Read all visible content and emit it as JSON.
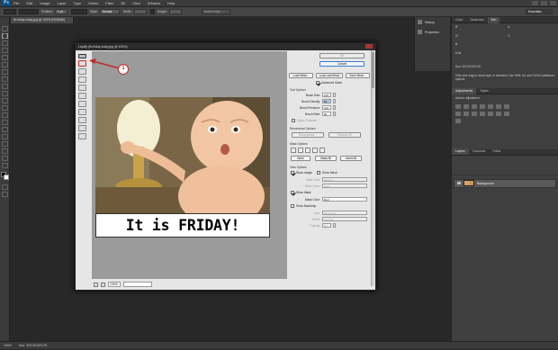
{
  "app": {
    "logo": "Ps"
  },
  "menu": [
    "File",
    "Edit",
    "Image",
    "Layer",
    "Type",
    "Select",
    "Filter",
    "3D",
    "View",
    "Window",
    "Help"
  ],
  "options_bar": {
    "feather_label": "Feather:",
    "feather_value": "0 px",
    "style_label": "Style:",
    "style_value": "Normal",
    "width_label": "Width:",
    "height_label": "Height:",
    "refine_button": "Refine Edge..."
  },
  "document_tab": "fb-friday-baby.jpg @ 100% (RGB/8#)",
  "dock": {
    "items": [
      {
        "label": "History",
        "icon": "history-icon"
      },
      {
        "label": "Properties",
        "icon": "properties-icon"
      }
    ]
  },
  "workspace_selector": "Essentials",
  "right_panel": {
    "top_tabs": [
      "Color",
      "Swatches",
      "Info"
    ],
    "info_lines": [
      "R:",
      "G:",
      "B:",
      "8-bit",
      "X:",
      "Y:",
      "Doc: 323.2K/323.2K",
      "Click and drag to move layer or selection. Use Shift, Alt, and Ctrl for additional options."
    ],
    "adjust_tabs": [
      "Adjustments",
      "Styles"
    ],
    "adjust_title": "Add an adjustment",
    "layers_tabs": [
      "Layers",
      "Channels",
      "Paths"
    ],
    "layer_name": "Background"
  },
  "status_bar": {
    "zoom": "100%",
    "doc": "Doc: 323.2K/323.2K",
    "tabs": [
      "Mini Bridge",
      "Timeline"
    ]
  },
  "callout_number": "1",
  "liquify": {
    "title": "Liquify (fb-friday-baby.jpg @ 100%)",
    "caption": "It is FRIDAY!",
    "zoom_value": "100%",
    "ok": "OK",
    "cancel": "Cancel",
    "load_mesh": "Load Mesh...",
    "load_last_mesh": "Load Last Mesh",
    "save_mesh": "Save Mesh...",
    "advanced_mode": "Advanced Mode",
    "tool_options": "Tool Options",
    "brush_size_label": "Brush Size:",
    "brush_size": "100",
    "brush_density_label": "Brush Density:",
    "brush_density": "50",
    "brush_pressure_label": "Brush Pressure:",
    "brush_pressure": "100",
    "brush_rate_label": "Brush Rate:",
    "brush_rate": "80",
    "stylus_pressure": "Stylus Pressure",
    "reconstruct_options": "Reconstruct Options",
    "reconstruct_btn": "Reconstruct...",
    "restore_all": "Restore All",
    "mask_options": "Mask Options",
    "none": "None",
    "mask_all": "Mask All",
    "invert_all": "Invert All",
    "view_options": "View Options",
    "show_image": "Show Image",
    "show_mesh": "Show Mesh",
    "mesh_size_label": "Mesh Size:",
    "mesh_size": "Medium",
    "mesh_color_label": "Mesh Color:",
    "mesh_color": "Gray",
    "show_mask": "Show Mask",
    "mask_color_label": "Mask Color:",
    "mask_color": "Red",
    "show_backdrop": "Show Backdrop",
    "use_label": "Use:",
    "use_value": "All Layers",
    "mode_label": "Mode:",
    "mode_value": "In Front",
    "opacity_label": "Opacity:",
    "opacity_value": "50"
  },
  "colors": {
    "accent": "#c42a2a",
    "ps_blue": "#0d4b7a"
  }
}
